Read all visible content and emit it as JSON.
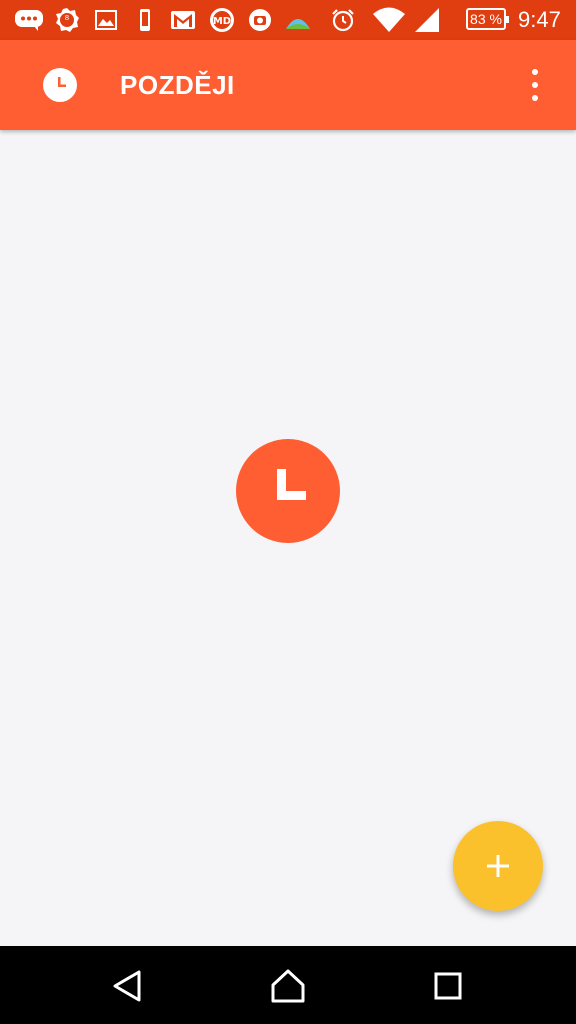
{
  "status_bar": {
    "battery_level": "83 %",
    "time": "9:47",
    "notification_icons": [
      "chat-icon",
      "badge-icon",
      "image-icon",
      "phone-icon",
      "gmail-icon",
      "md-icon",
      "app-icon",
      "weather-icon"
    ],
    "system_icons": [
      "alarm-icon",
      "wifi-icon",
      "signal-icon",
      "battery-icon"
    ]
  },
  "app_bar": {
    "title": "POZDĚJI",
    "icon": "clock-icon",
    "menu_icon": "overflow-menu-icon"
  },
  "content": {
    "empty_state_icon": "clock-icon"
  },
  "fab": {
    "label": "+",
    "icon": "plus-icon"
  },
  "nav_bar": {
    "buttons": [
      "back-icon",
      "home-icon",
      "recents-icon"
    ]
  },
  "colors": {
    "status_bar": "#e03d10",
    "app_bar": "#ff5e33",
    "accent": "#fbc12d",
    "background": "#f5f5f7"
  }
}
